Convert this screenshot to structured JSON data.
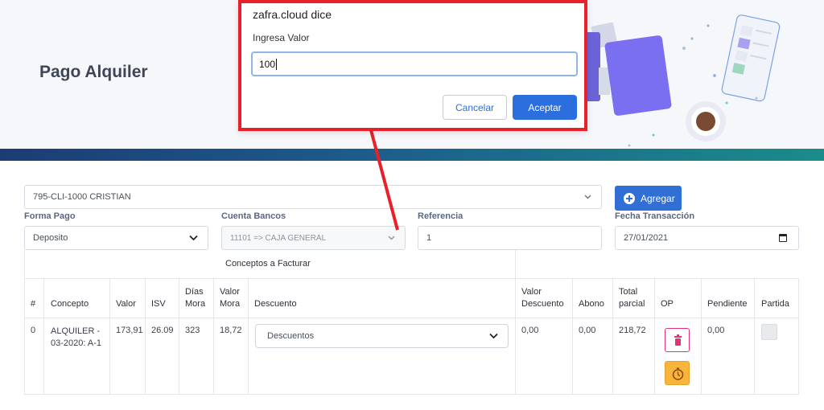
{
  "page": {
    "title": "Pago Alquiler",
    "accent_color": "#2f6fd6",
    "highlight_color": "#e8202a"
  },
  "form": {
    "cliente_value": "795-CLI-1000 CRISTIAN",
    "agregar_label": "Agregar",
    "forma_pago_label": "Forma Pago",
    "forma_pago_value": "Deposito",
    "cuenta_bancos_label": "Cuenta Bancos",
    "cuenta_bancos_value": "11101 => CAJA GENERAL",
    "referencia_label": "Referencia",
    "referencia_value": "1",
    "fecha_label": "Fecha Transacción",
    "fecha_value": "27/01/2021"
  },
  "table": {
    "group_header": "Conceptos a Facturar",
    "headers": {
      "num": "#",
      "concepto": "Concepto",
      "valor": "Valor",
      "isv": "ISV",
      "dias_mora_1": "Días",
      "dias_mora_2": "Mora",
      "valor_mora_1": "Valor",
      "valor_mora_2": "Mora",
      "descuento": "Descuento",
      "valor_descuento_1": "Valor",
      "valor_descuento_2": "Descuento",
      "abono": "Abono",
      "total_parcial_1": "Total",
      "total_parcial_2": "parcial",
      "op": "OP",
      "pendiente": "Pendiente",
      "partida": "Partida"
    },
    "rows": [
      {
        "num": "0",
        "concepto_1": "ALQUILER -",
        "concepto_2": "03-2020: A-1",
        "valor": "173,91",
        "isv": "26.09",
        "dias_mora": "323",
        "valor_mora": "18,72",
        "descuento": "Descuentos",
        "valor_descuento": "0,00",
        "abono": "0,00",
        "total_parcial": "218,72",
        "pendiente": "0,00"
      }
    ]
  },
  "dialog": {
    "title": "zafra.cloud dice",
    "message": "Ingresa Valor",
    "input_value": "100",
    "cancel_label": "Cancelar",
    "accept_label": "Aceptar"
  },
  "icons": [
    "plus-circle-icon",
    "chevron-down-icon",
    "calendar-icon",
    "trash-icon",
    "timer-icon",
    "red-arrow-annotation"
  ]
}
